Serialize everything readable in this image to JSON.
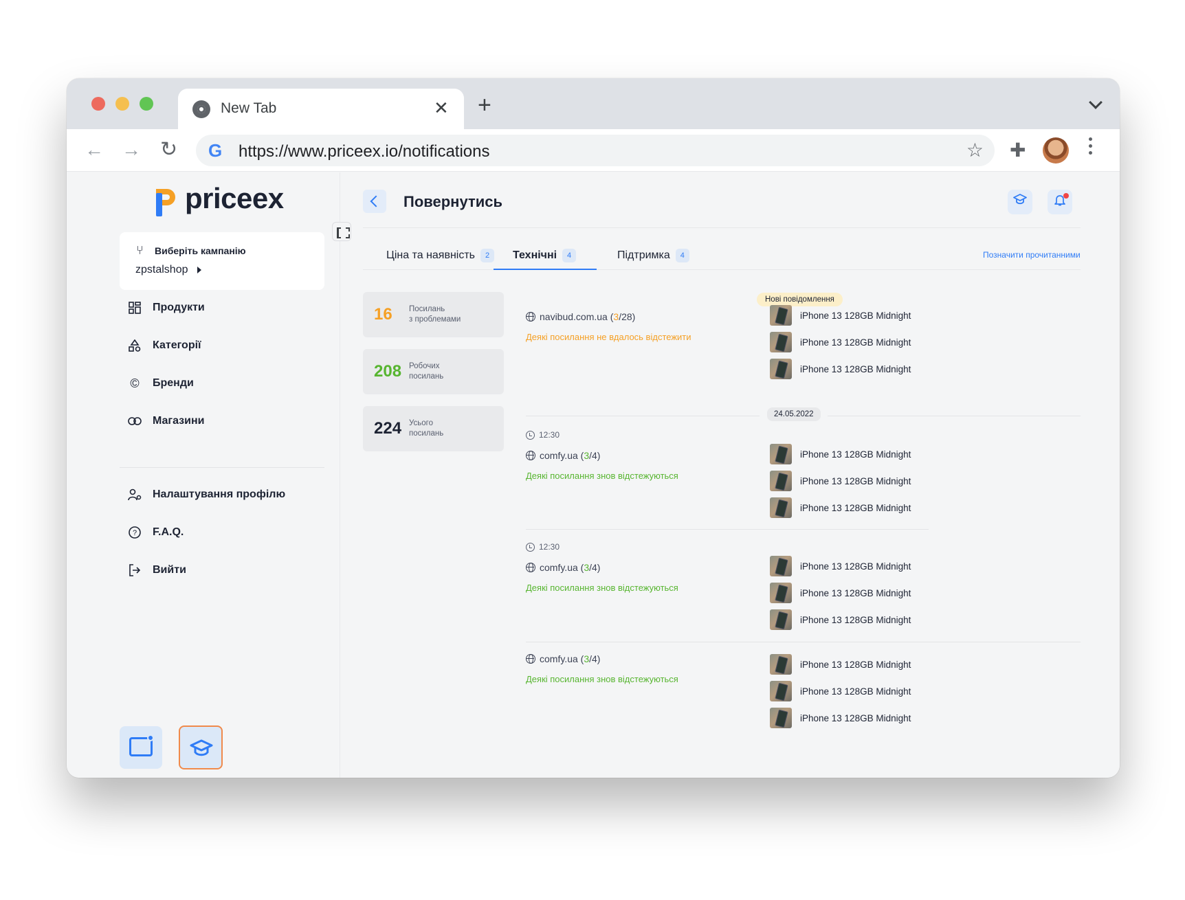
{
  "browser": {
    "tab_title": "New Tab",
    "tab_close": "✕",
    "new_tab": "+",
    "url": "https://www.priceex.io/notifications"
  },
  "sidebar": {
    "logo_text": "priceex",
    "campaign_label": "Виберіть кампанію",
    "campaign_value": "zpstalshop",
    "menu": [
      {
        "label": "Продукти",
        "icon": "grid-icon"
      },
      {
        "label": "Категорії",
        "icon": "shapes-icon"
      },
      {
        "label": "Бренди",
        "icon": "copyright-icon"
      },
      {
        "label": "Магазини",
        "icon": "link-icon"
      }
    ],
    "menu_secondary": [
      {
        "label": "Налаштування профілю",
        "icon": "user-settings-icon"
      },
      {
        "label": "F.A.Q.",
        "icon": "question-icon"
      },
      {
        "label": "Вийти",
        "icon": "logout-icon"
      }
    ]
  },
  "header": {
    "title": "Повернутись"
  },
  "tabs": [
    {
      "label": "Ціна та наявність",
      "count": "2"
    },
    {
      "label": "Технічні",
      "count": "4"
    },
    {
      "label": "Підтримка",
      "count": "4"
    }
  ],
  "mark_read": "Позначити прочитанними",
  "stats": [
    {
      "value": "16",
      "label1": "Посилань",
      "label2": "з проблемами",
      "color": "#f5a025"
    },
    {
      "value": "208",
      "label1": "Робочих",
      "label2": "посилань",
      "color": "#57b530"
    },
    {
      "value": "224",
      "label1": "Усього",
      "label2": "посилань",
      "color": "#1d2333"
    }
  ],
  "feed": {
    "new_badge": "Нові повідомлення",
    "date_badge": "24.05.2022",
    "groups": [
      {
        "time": "",
        "store": "navibud.com.ua",
        "ratio_hl": "3",
        "ratio_total": "/28)",
        "note": "Деякі посилання не вдалось відстежити",
        "products": [
          "iPhone 13 128GB Midnight",
          "iPhone 13 128GB Midnight",
          "iPhone 13 128GB Midnight"
        ]
      },
      {
        "time": "12:30",
        "store": "comfy.ua",
        "ratio_hl": "3",
        "ratio_total": "/4)",
        "note": "Деякі посилання знов відстежуються",
        "products": [
          "iPhone 13 128GB Midnight",
          "iPhone 13 128GB Midnight",
          "iPhone 13 128GB Midnight"
        ]
      },
      {
        "time": "12:30",
        "store": "comfy.ua",
        "ratio_hl": "3",
        "ratio_total": "/4)",
        "note": "Деякі посилання знов відстежуються",
        "products": [
          "iPhone 13 128GB Midnight",
          "iPhone 13 128GB Midnight",
          "iPhone 13 128GB Midnight"
        ]
      },
      {
        "time": "",
        "store": "comfy.ua",
        "ratio_hl": "3",
        "ratio_total": "/4)",
        "note": "Деякі посилання знов відстежуються",
        "products": [
          "iPhone 13 128GB Midnight",
          "iPhone 13 128GB Midnight",
          "iPhone 13 128GB Midnight"
        ]
      }
    ]
  }
}
